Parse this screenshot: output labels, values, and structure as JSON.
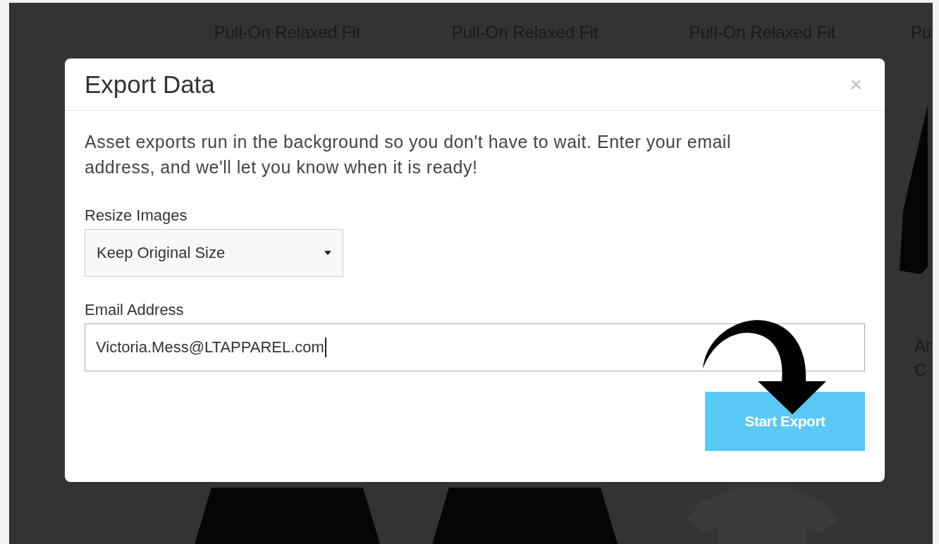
{
  "background_products": [
    {
      "title": "Pull-On Relaxed Fit",
      "kind": "dress"
    },
    {
      "title": "Pull-On Relaxed Fit",
      "kind": "dress"
    },
    {
      "title": "Pull-On Relaxed Fit",
      "kind": "shirt"
    },
    {
      "title": "Pu",
      "kind": "jacket",
      "caption": [
        "Ar",
        "C"
      ]
    }
  ],
  "dialog": {
    "title": "Export Data",
    "close": "×",
    "description": "Asset exports run in the background so you don't have to wait. Enter your email address, and we'll let you know when it is ready!",
    "resize": {
      "label": "Resize Images",
      "value": "Keep Original Size"
    },
    "email": {
      "label": "Email Address",
      "value": "Victoria.Mess@LTAPPAREL.com"
    },
    "button": "Start Export"
  }
}
